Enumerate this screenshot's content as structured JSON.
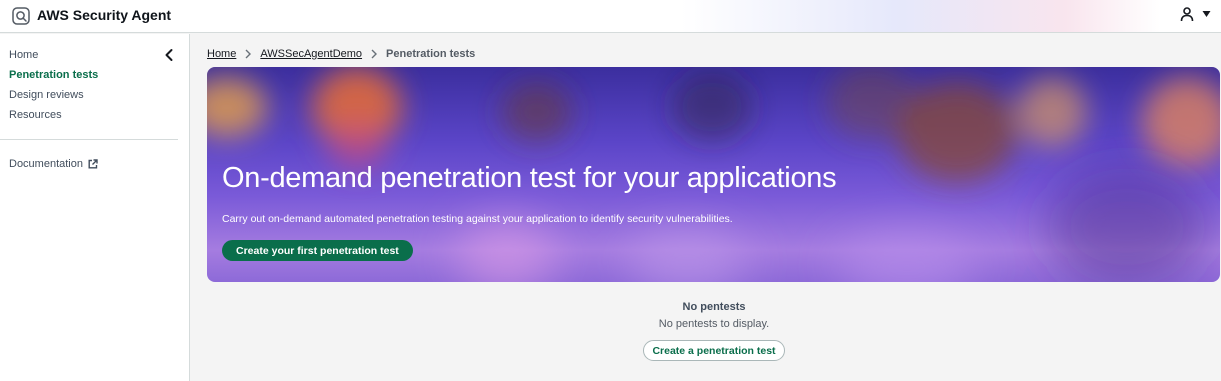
{
  "app": {
    "title": "AWS Security Agent",
    "logo_icon": "shield-icon"
  },
  "user_menu": {
    "icon": "user-icon",
    "caret_icon": "caret-down-icon"
  },
  "sidebar": {
    "items": [
      {
        "label": "Home",
        "active": false
      },
      {
        "label": "Penetration tests",
        "active": true
      },
      {
        "label": "Design reviews",
        "active": false
      },
      {
        "label": "Resources",
        "active": false
      }
    ],
    "documentation": {
      "label": "Documentation",
      "icon": "external-link-icon"
    },
    "collapse_icon": "chevron-left-icon"
  },
  "breadcrumb": {
    "items": [
      "Home",
      "AWSSecAgentDemo"
    ],
    "current": "Penetration tests"
  },
  "hero": {
    "title": "On-demand penetration test for your applications",
    "subtitle": "Carry out on-demand automated penetration testing against your application to identify security vulnerabilities.",
    "button_label": "Create your first penetration test"
  },
  "empty_state": {
    "title": "No pentests",
    "description": "No pentests to display.",
    "button_label": "Create a penetration test"
  },
  "colors": {
    "accent": "#0a6e4b",
    "hero_gradient_top": "#3b2e9e",
    "hero_gradient_bottom": "#a57ce0"
  }
}
